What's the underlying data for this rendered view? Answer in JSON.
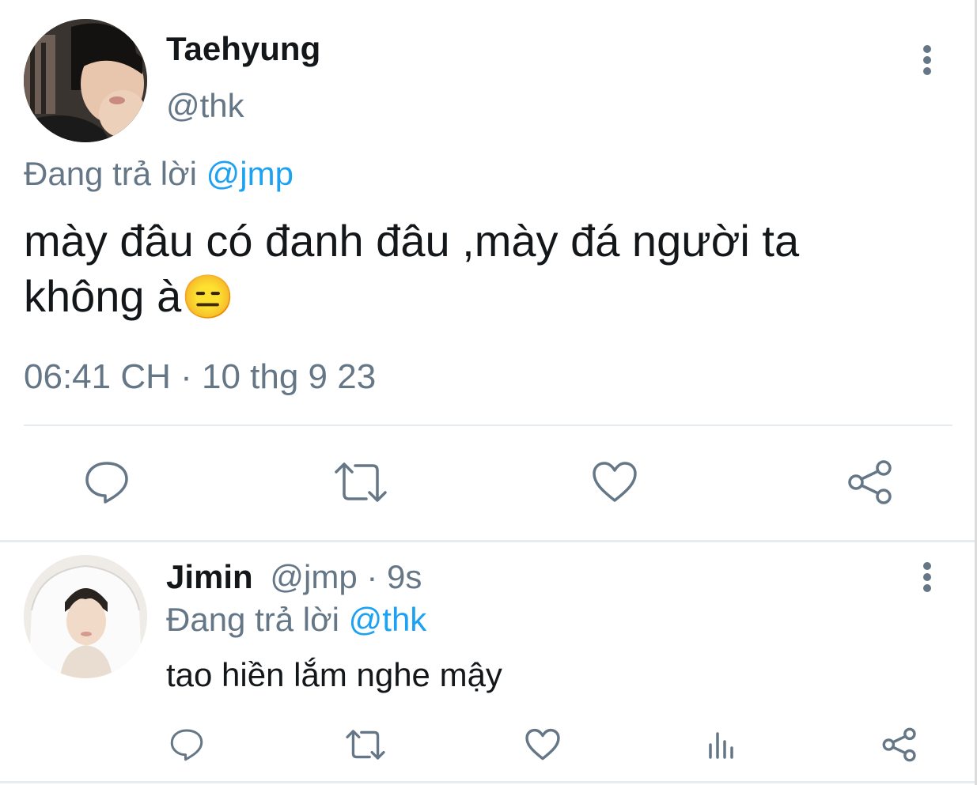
{
  "main_tweet": {
    "display_name": "Taehyung",
    "handle": "@thk",
    "replying_prefix": "Đang trả lời",
    "replying_to": "@jmp",
    "text": "mày đâu có đanh đâu ,mày đá người ta không à",
    "emoji": "😑",
    "timestamp": "06:41 CH · 10 thg 9 23",
    "avatar_icon": "avatar-taehyung",
    "actions": [
      "reply-icon",
      "retweet-icon",
      "like-icon",
      "share-icon"
    ]
  },
  "reply_tweet": {
    "display_name": "Jimin",
    "handle": "@jmp",
    "time_ago": "· 9s",
    "replying_prefix": "Đang trả lời",
    "replying_to": "@thk",
    "text": "tao hiền lắm nghe mậy",
    "avatar_icon": "avatar-jimin",
    "actions": [
      "reply-icon",
      "retweet-icon",
      "like-icon",
      "analytics-icon",
      "share-icon"
    ]
  },
  "colors": {
    "link": "#1da1f2",
    "muted": "#657786",
    "text": "#14171a",
    "divider": "#e6ecf0"
  }
}
